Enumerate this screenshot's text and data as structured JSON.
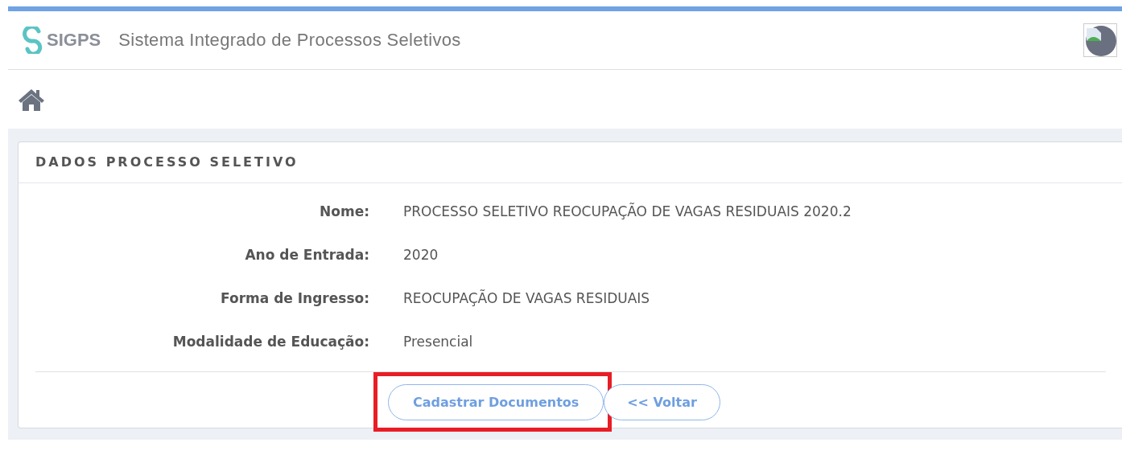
{
  "header": {
    "logo_text": "SIGPS",
    "title": "Sistema Integrado de Processos Seletivos"
  },
  "card": {
    "title": "DADOS PROCESSO SELETIVO",
    "fields": [
      {
        "label": "Nome:",
        "value": "PROCESSO SELETIVO REOCUPAÇÃO DE VAGAS RESIDUAIS 2020.2"
      },
      {
        "label": "Ano de Entrada:",
        "value": "2020"
      },
      {
        "label": "Forma de Ingresso:",
        "value": "REOCUPAÇÃO DE VAGAS RESIDUAIS"
      },
      {
        "label": "Modalidade de Educação:",
        "value": "Presencial"
      }
    ],
    "buttons": [
      {
        "label": "Cadastrar Documentos",
        "highlighted": true
      },
      {
        "label": "<< Voltar",
        "highlighted": false
      }
    ]
  }
}
